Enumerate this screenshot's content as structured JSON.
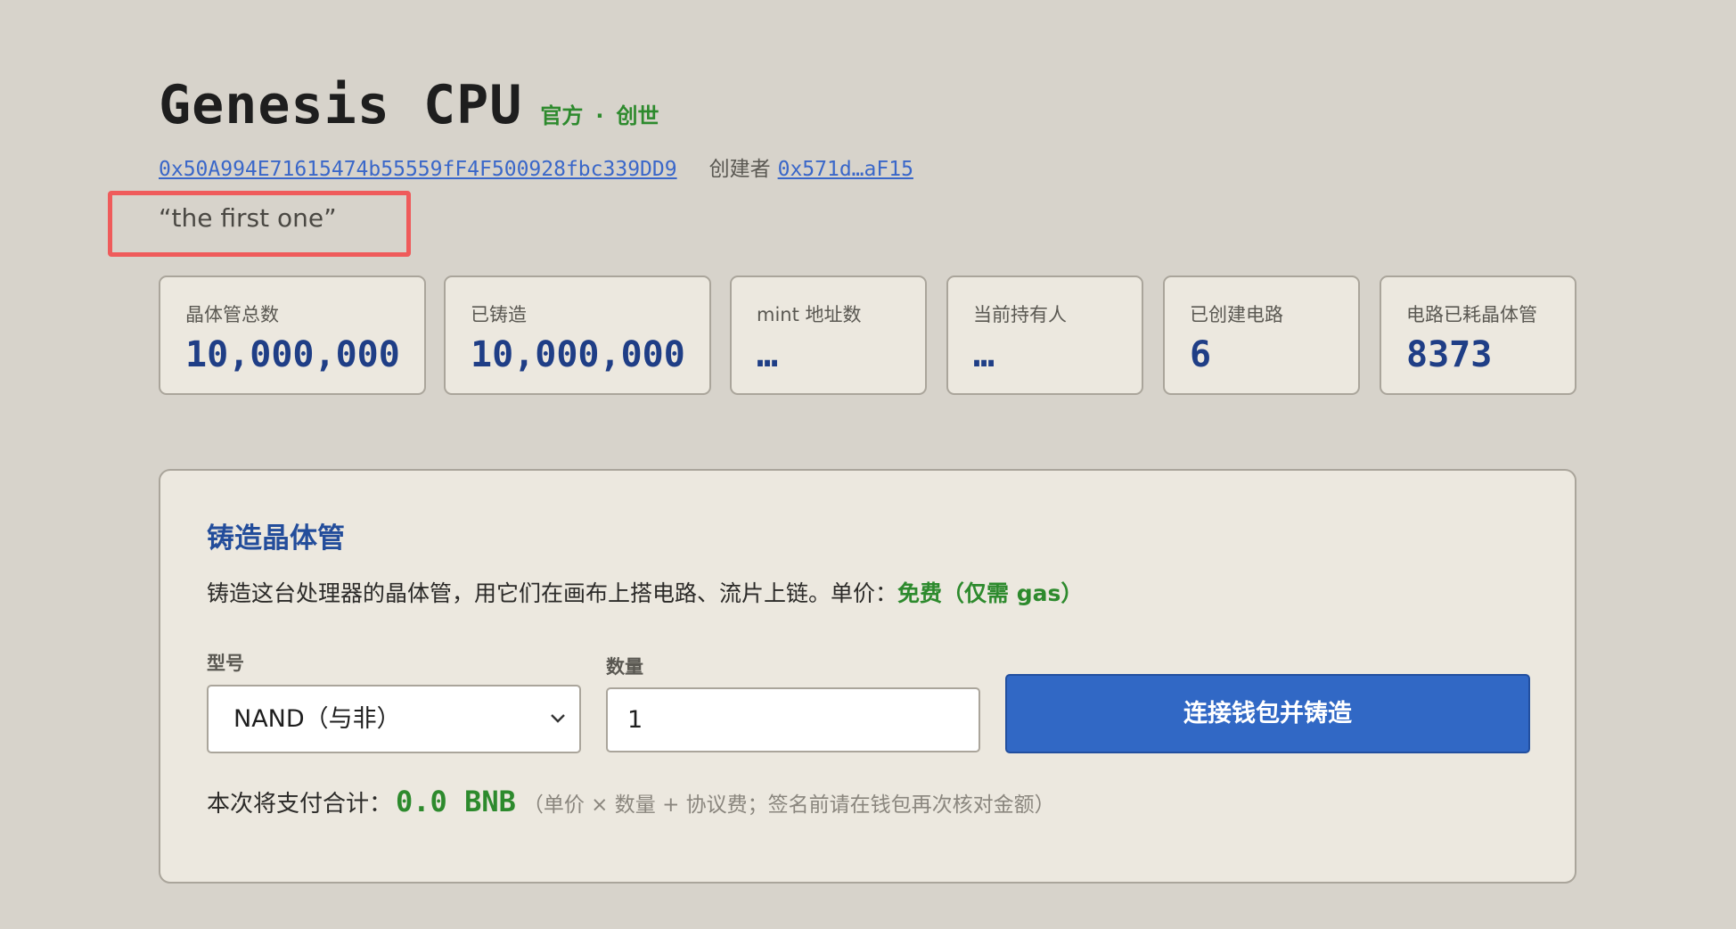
{
  "header": {
    "title": "Genesis CPU",
    "tag_official": "官方",
    "tag_separator": "·",
    "tag_genesis": "创世",
    "contract_address": "0x50A994E71615474b55559fF4F500928fbc339DD9",
    "creator_label": "创建者",
    "creator_address": "0x571d…aF15",
    "quote": "“the first one”"
  },
  "stats": [
    {
      "label": "晶体管总数",
      "value": "10,000,000"
    },
    {
      "label": "已铸造",
      "value": "10,000,000"
    },
    {
      "label": "mint 地址数",
      "value": "…"
    },
    {
      "label": "当前持有人",
      "value": "…"
    },
    {
      "label": "已创建电路",
      "value": "6"
    },
    {
      "label": "电路已耗晶体管",
      "value": "8373"
    }
  ],
  "mint": {
    "title": "铸造晶体管",
    "description": "铸造这台处理器的晶体管，用它们在画布上搭电路、流片上链。单价：",
    "price": "免费（仅需 gas）",
    "model_label": "型号",
    "model_value": "NAND（与非）",
    "quantity_label": "数量",
    "quantity_value": "1",
    "button_label": "连接钱包并铸造",
    "total_label": "本次将支付合计：",
    "total_amount": "0.0 BNB",
    "total_note": "（单价 × 数量 + 协议费；签名前请在钱包再次核对金额）"
  },
  "colors": {
    "background": "#d7d3cb",
    "card": "#ece8df",
    "accent_blue": "#3168c5",
    "green": "#2d8a2d",
    "stat_value": "#1f3e86",
    "highlight_border": "#ef5b5b"
  }
}
